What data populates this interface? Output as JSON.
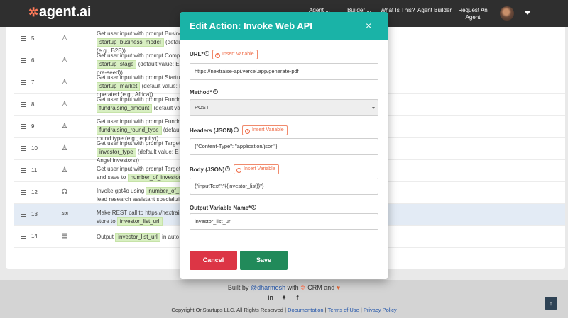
{
  "header": {
    "logo_text": "agent.ai",
    "nav": [
      {
        "label": "Agent ..."
      },
      {
        "label": "Builder ..."
      },
      {
        "label": "What Is This?"
      },
      {
        "label": "Agent Builder"
      },
      {
        "label": "Request An Agent"
      }
    ]
  },
  "rows": [
    {
      "num": "5",
      "icon": "person-icon",
      "line1": "Get user input with prompt Busine",
      "tag": "startup_business_model",
      "after": "(default",
      "line3": "(e.g., B2B))"
    },
    {
      "num": "6",
      "icon": "person-icon",
      "line1": "Get user input with prompt Compa",
      "tag": "startup_stage",
      "after": "(default value: E",
      "line3": "pre-seed))"
    },
    {
      "num": "7",
      "icon": "person-icon",
      "line1": "Get user input with prompt Startu",
      "tag": "startup_market",
      "after": "(default value: E",
      "line3": "operated (e.g., Africa))"
    },
    {
      "num": "8",
      "icon": "person-icon",
      "line1": "Get user input with prompt Fundr",
      "tag": "fundraising_amount",
      "after": "(default va",
      "line3": ""
    },
    {
      "num": "9",
      "icon": "person-icon",
      "line1": "Get user input with prompt Fundr",
      "tag": "fundraising_round_type",
      "after": "(defau",
      "line3": "round type (e.g., equity))"
    },
    {
      "num": "10",
      "icon": "person-icon",
      "line1": "Get user input with prompt Target",
      "tag": "investor_type",
      "after": "(default value: E",
      "line3": "Angel investors))"
    },
    {
      "num": "11",
      "icon": "person-icon",
      "line1": "Get user input with prompt Target",
      "pre": "and save to",
      "tag": "number_of_investors",
      "after": "",
      "line3": ""
    },
    {
      "num": "12",
      "icon": "brain-icon",
      "line1": "Invoke gpt4o using",
      "tag": "number_of_",
      "after": "",
      "line3": "lead research assistant specializin"
    },
    {
      "num": "13",
      "icon": "api-icon",
      "line1": "Make REST call to https://nextraise",
      "pre": "store to",
      "tag": "investor_list_url",
      "after": "",
      "line3": ""
    },
    {
      "num": "14",
      "icon": "output-icon",
      "line1": "",
      "pre": "Output",
      "tag": "investor_list_url",
      "after": "in auto",
      "line3": ""
    }
  ],
  "modal": {
    "title": "Edit Action: Invoke Web API",
    "close_symbol": "×",
    "url_label": "URL*",
    "insert_variable": "Insert Variable",
    "url_value": "https://nextraise-api.vercel.app/generate-pdf",
    "method_label": "Method*",
    "method_value": "POST",
    "headers_label": "Headers (JSON)",
    "headers_value": "{\"Content-Type\": \"application/json\"}",
    "body_label": "Body (JSON)",
    "body_value": "{\"inputText\":\"{{investor_list}}\"}",
    "output_label": "Output Variable Name*",
    "output_value": "investor_list_url",
    "cancel_label": "Cancel",
    "save_label": "Save"
  },
  "footer": {
    "built_by": "Built by",
    "author": "@dharmesh",
    "with": "with",
    "crm": "CRM and",
    "copyright": "Copyright OnStartups LLC, All Rights Reserved |",
    "documentation": "Documentation",
    "sep1": "|",
    "terms": "Terms of Use",
    "sep2": "|",
    "privacy": "Privacy Policy",
    "back_to_top": "↑"
  },
  "colors": {
    "modal_header": "#1ab3a7",
    "cancel": "#dc3545",
    "save": "#218a5a",
    "accent": "#ff7a59",
    "variable_tag": "#d8efc2"
  }
}
